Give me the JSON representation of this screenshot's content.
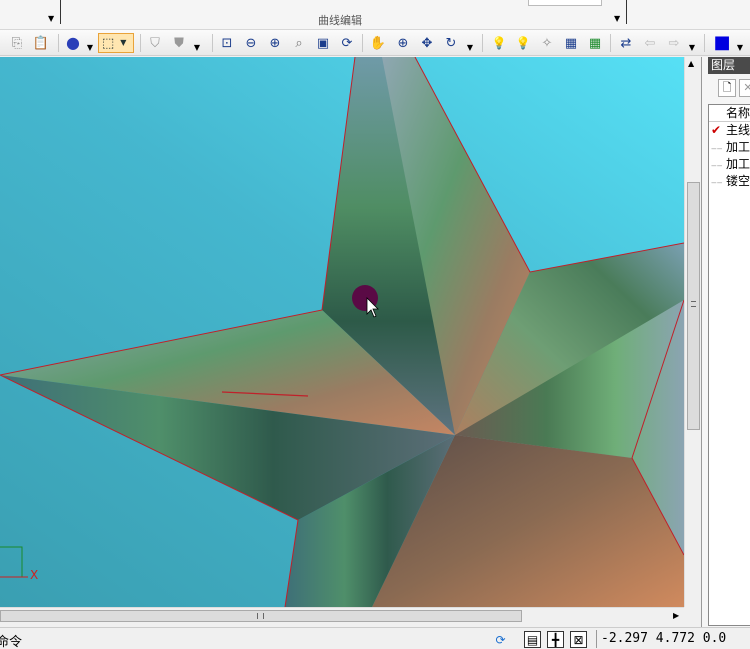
{
  "ribbon": {
    "group_label": "曲线编辑"
  },
  "toolbar": {
    "buttons": [
      {
        "icon": "copy-icon",
        "glyph": "⎘"
      },
      {
        "icon": "paste-icon",
        "glyph": "📋"
      },
      {
        "icon": "sphere-shading-icon",
        "glyph": "●"
      },
      {
        "icon": "box-view-icon",
        "glyph": "⬚"
      },
      {
        "icon": "shield-icon",
        "glyph": "⛉"
      },
      {
        "icon": "shield-filled-icon",
        "glyph": "⛊"
      },
      {
        "icon": "zoom-window-icon",
        "glyph": "⊡"
      },
      {
        "icon": "zoom-out-icon",
        "glyph": "⊖"
      },
      {
        "icon": "zoom-in-icon",
        "glyph": "⊕"
      },
      {
        "icon": "zoom-all-icon",
        "glyph": "⌕"
      },
      {
        "icon": "zoom-extents-icon",
        "glyph": "▣"
      },
      {
        "icon": "rotate-view-icon",
        "glyph": "⟳"
      },
      {
        "icon": "pan-hand-icon",
        "glyph": "✋"
      },
      {
        "icon": "zoom-plus-icon",
        "glyph": "⊕"
      },
      {
        "icon": "move-cross-icon",
        "glyph": "✥"
      },
      {
        "icon": "spin-icon",
        "glyph": "↻"
      },
      {
        "icon": "bulb-blue-icon",
        "glyph": "💡"
      },
      {
        "icon": "bulb-green-icon",
        "glyph": "💡"
      },
      {
        "icon": "light-settings-icon",
        "glyph": "✧"
      },
      {
        "icon": "select-frame-icon",
        "glyph": "▦"
      },
      {
        "icon": "select-frame-green-icon",
        "glyph": "▦"
      },
      {
        "icon": "regenerate-icon",
        "glyph": "⇄"
      },
      {
        "icon": "back-arrow-icon",
        "glyph": "⇦"
      },
      {
        "icon": "forward-arrow-icon",
        "glyph": "⇨"
      },
      {
        "icon": "color-swatch-icon",
        "glyph": "■"
      }
    ]
  },
  "panel": {
    "title": "图层",
    "column_header": "名称",
    "layers": [
      {
        "name": "主线",
        "checked": true
      },
      {
        "name": "加工",
        "checked": false
      },
      {
        "name": "加工",
        "checked": false
      },
      {
        "name": "镂空",
        "checked": false
      }
    ]
  },
  "viewport": {
    "axis_label": "X"
  },
  "status": {
    "command_text": "命令",
    "coordinates": "-2.297  4.772  0.0"
  }
}
